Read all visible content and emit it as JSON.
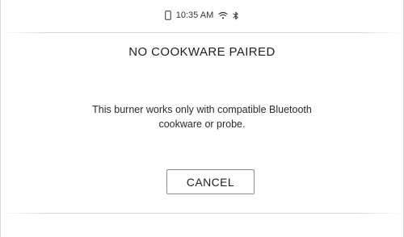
{
  "status_bar": {
    "time": "10:35 AM",
    "icons": [
      "phone-icon",
      "wifi-icon",
      "bluetooth-icon"
    ]
  },
  "dialog": {
    "title": "NO COOKWARE PAIRED",
    "message_line1": "This burner works only with compatible Bluetooth",
    "message_line2": "cookware or probe.",
    "cancel_label": "CANCEL"
  }
}
